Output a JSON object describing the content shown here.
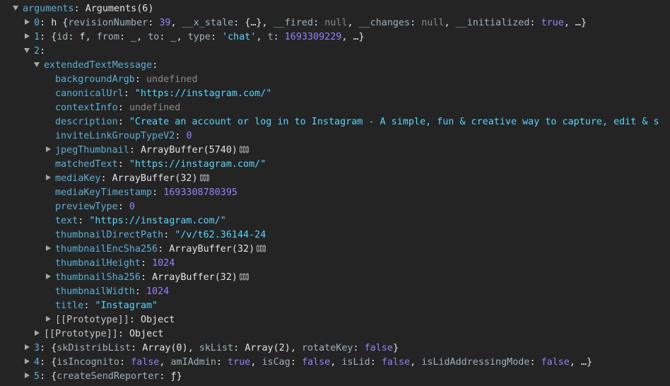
{
  "root": {
    "key": "arguments",
    "value": "Arguments(6)"
  },
  "item0": {
    "index": "0",
    "prefix": "h {",
    "k1": "revisionNumber",
    "v1": "39",
    "k2": "__x_stale",
    "v2": "{…}",
    "k3": "__fired",
    "v3": "null",
    "k4": "__changes",
    "v4": "null",
    "k5": "__initialized",
    "v5": "true",
    "suffix": ", …}"
  },
  "item1": {
    "index": "1",
    "k1": "id",
    "v1": "f",
    "k2": "from",
    "v2": "_",
    "k3": "to",
    "v3": "_",
    "k4": "type",
    "v4": "'chat'",
    "k5": "t",
    "v5": "1693309229",
    "suffix": ", …}"
  },
  "item2": {
    "index": "2"
  },
  "ext": {
    "key": "extendedTextMessage",
    "props": {
      "backgroundArgb": {
        "key": "backgroundArgb",
        "value": "undefined"
      },
      "canonicalUrl": {
        "key": "canonicalUrl",
        "value": "\"https://instagram.com/\""
      },
      "contextInfo": {
        "key": "contextInfo",
        "value": "undefined"
      },
      "description": {
        "key": "description",
        "value": "\"Create an account or log in to Instagram - A simple, fun & creative way to capture, edit & s"
      },
      "inviteLinkGroupTypeV2": {
        "key": "inviteLinkGroupTypeV2",
        "value": "0"
      },
      "jpegThumbnail": {
        "key": "jpegThumbnail",
        "value": "ArrayBuffer(5740)"
      },
      "matchedText": {
        "key": "matchedText",
        "value": "\"https://instagram.com/\""
      },
      "mediaKey": {
        "key": "mediaKey",
        "value": "ArrayBuffer(32)"
      },
      "mediaKeyTimestamp": {
        "key": "mediaKeyTimestamp",
        "value": "1693308780395"
      },
      "previewType": {
        "key": "previewType",
        "value": "0"
      },
      "text": {
        "key": "text",
        "value": "\"https://instagram.com/\""
      },
      "thumbnailDirectPath": {
        "key": "thumbnailDirectPath",
        "value": "\"/v/t62.36144-24"
      },
      "thumbnailEncSha256": {
        "key": "thumbnailEncSha256",
        "value": "ArrayBuffer(32)"
      },
      "thumbnailHeight": {
        "key": "thumbnailHeight",
        "value": "1024"
      },
      "thumbnailSha256": {
        "key": "thumbnailSha256",
        "value": "ArrayBuffer(32)"
      },
      "thumbnailWidth": {
        "key": "thumbnailWidth",
        "value": "1024"
      },
      "title": {
        "key": "title",
        "value": "\"Instagram\""
      }
    },
    "proto": {
      "key": "[[Prototype]]",
      "value": "Object"
    }
  },
  "item2proto": {
    "key": "[[Prototype]]",
    "value": "Object"
  },
  "item3": {
    "index": "3",
    "k1": "skDistribList",
    "v1": "Array(0)",
    "k2": "skList",
    "v2": "Array(2)",
    "k3": "rotateKey",
    "v3": "false"
  },
  "item4": {
    "index": "4",
    "k1": "isIncognito",
    "v1": "false",
    "k2": "amIAdmin",
    "v2": "true",
    "k3": "isCag",
    "v3": "false",
    "k4": "isLid",
    "v4": "false",
    "k5": "isLidAddressingMode",
    "v5": "false",
    "suffix": ", …}"
  },
  "item5": {
    "index": "5",
    "k1": "createSendReporter",
    "v1": "ƒ"
  },
  "punct": {
    "colon": ": ",
    "comma": ", ",
    "open": "{",
    "close": "}"
  },
  "icons": {
    "memory": "memory-inspector-icon",
    "expanded": "triangle-down-icon",
    "collapsed": "triangle-right-icon"
  }
}
